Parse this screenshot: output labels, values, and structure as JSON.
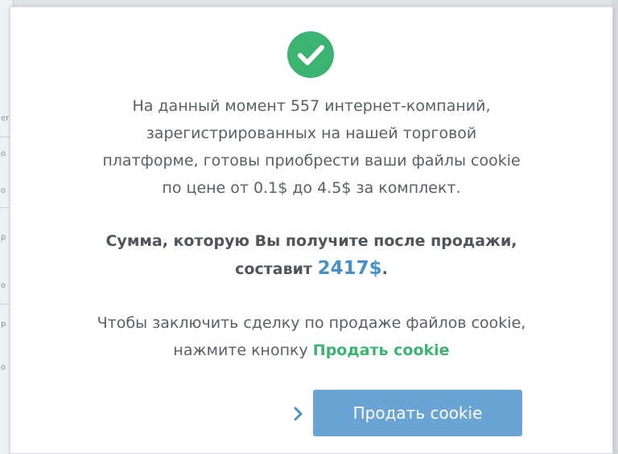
{
  "background": {
    "fragments": [
      "er",
      "o",
      "o",
      "p",
      "o",
      "p",
      "o"
    ]
  },
  "dialog": {
    "icon": "check-circle-icon",
    "info_lines": [
      "На данный момент 557 интернет-компаний,",
      "зарегистрированных на нашей торговой",
      "платформе, готовы приобрести ваши файлы cookie",
      "по цене от 0.1$ до 4.5$ за комплект."
    ],
    "sum_line1": "Сумма, которую Вы получите после продажи,",
    "sum_prefix": "составит",
    "sum_amount": "2417$",
    "sum_suffix": ".",
    "cta_line1": "Чтобы заключить сделку по продаже файлов cookie,",
    "cta_prefix": "нажмите кнопку",
    "cta_link": "Продать cookie",
    "button_label": "Продать cookie",
    "chevron_icon": "chevron-right-icon"
  },
  "colors": {
    "success": "#3cb371",
    "accent": "#4a90c8",
    "button": "#6aa4d4",
    "text": "#595f66"
  }
}
